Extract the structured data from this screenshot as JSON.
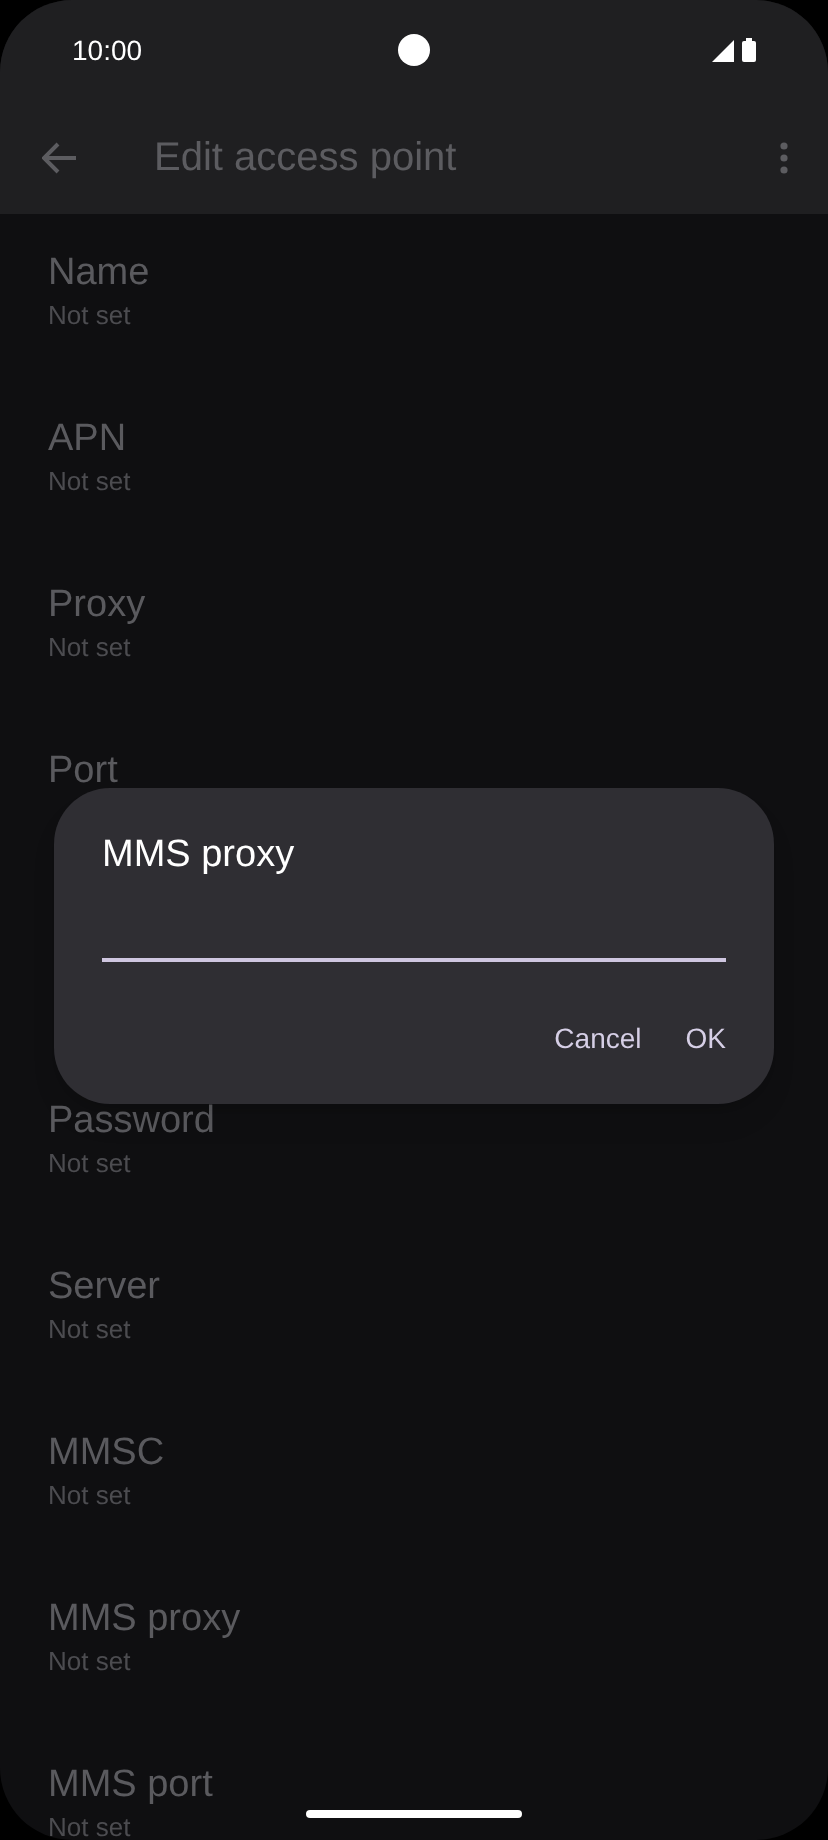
{
  "status_bar": {
    "time": "10:00"
  },
  "app_bar": {
    "title": "Edit access point"
  },
  "settings_above": [
    {
      "title": "Name",
      "summary": "Not set"
    },
    {
      "title": "APN",
      "summary": "Not set"
    },
    {
      "title": "Proxy",
      "summary": "Not set"
    },
    {
      "title": "Port"
    }
  ],
  "settings_below": [
    {
      "title": "Password",
      "summary": "Not set"
    },
    {
      "title": "Server",
      "summary": "Not set"
    },
    {
      "title": "MMSC",
      "summary": "Not set"
    },
    {
      "title": "MMS proxy",
      "summary": "Not set"
    },
    {
      "title": "MMS port",
      "summary": "Not set"
    }
  ],
  "dialog": {
    "title": "MMS proxy",
    "buttons": [
      "Cancel",
      "OK"
    ]
  }
}
